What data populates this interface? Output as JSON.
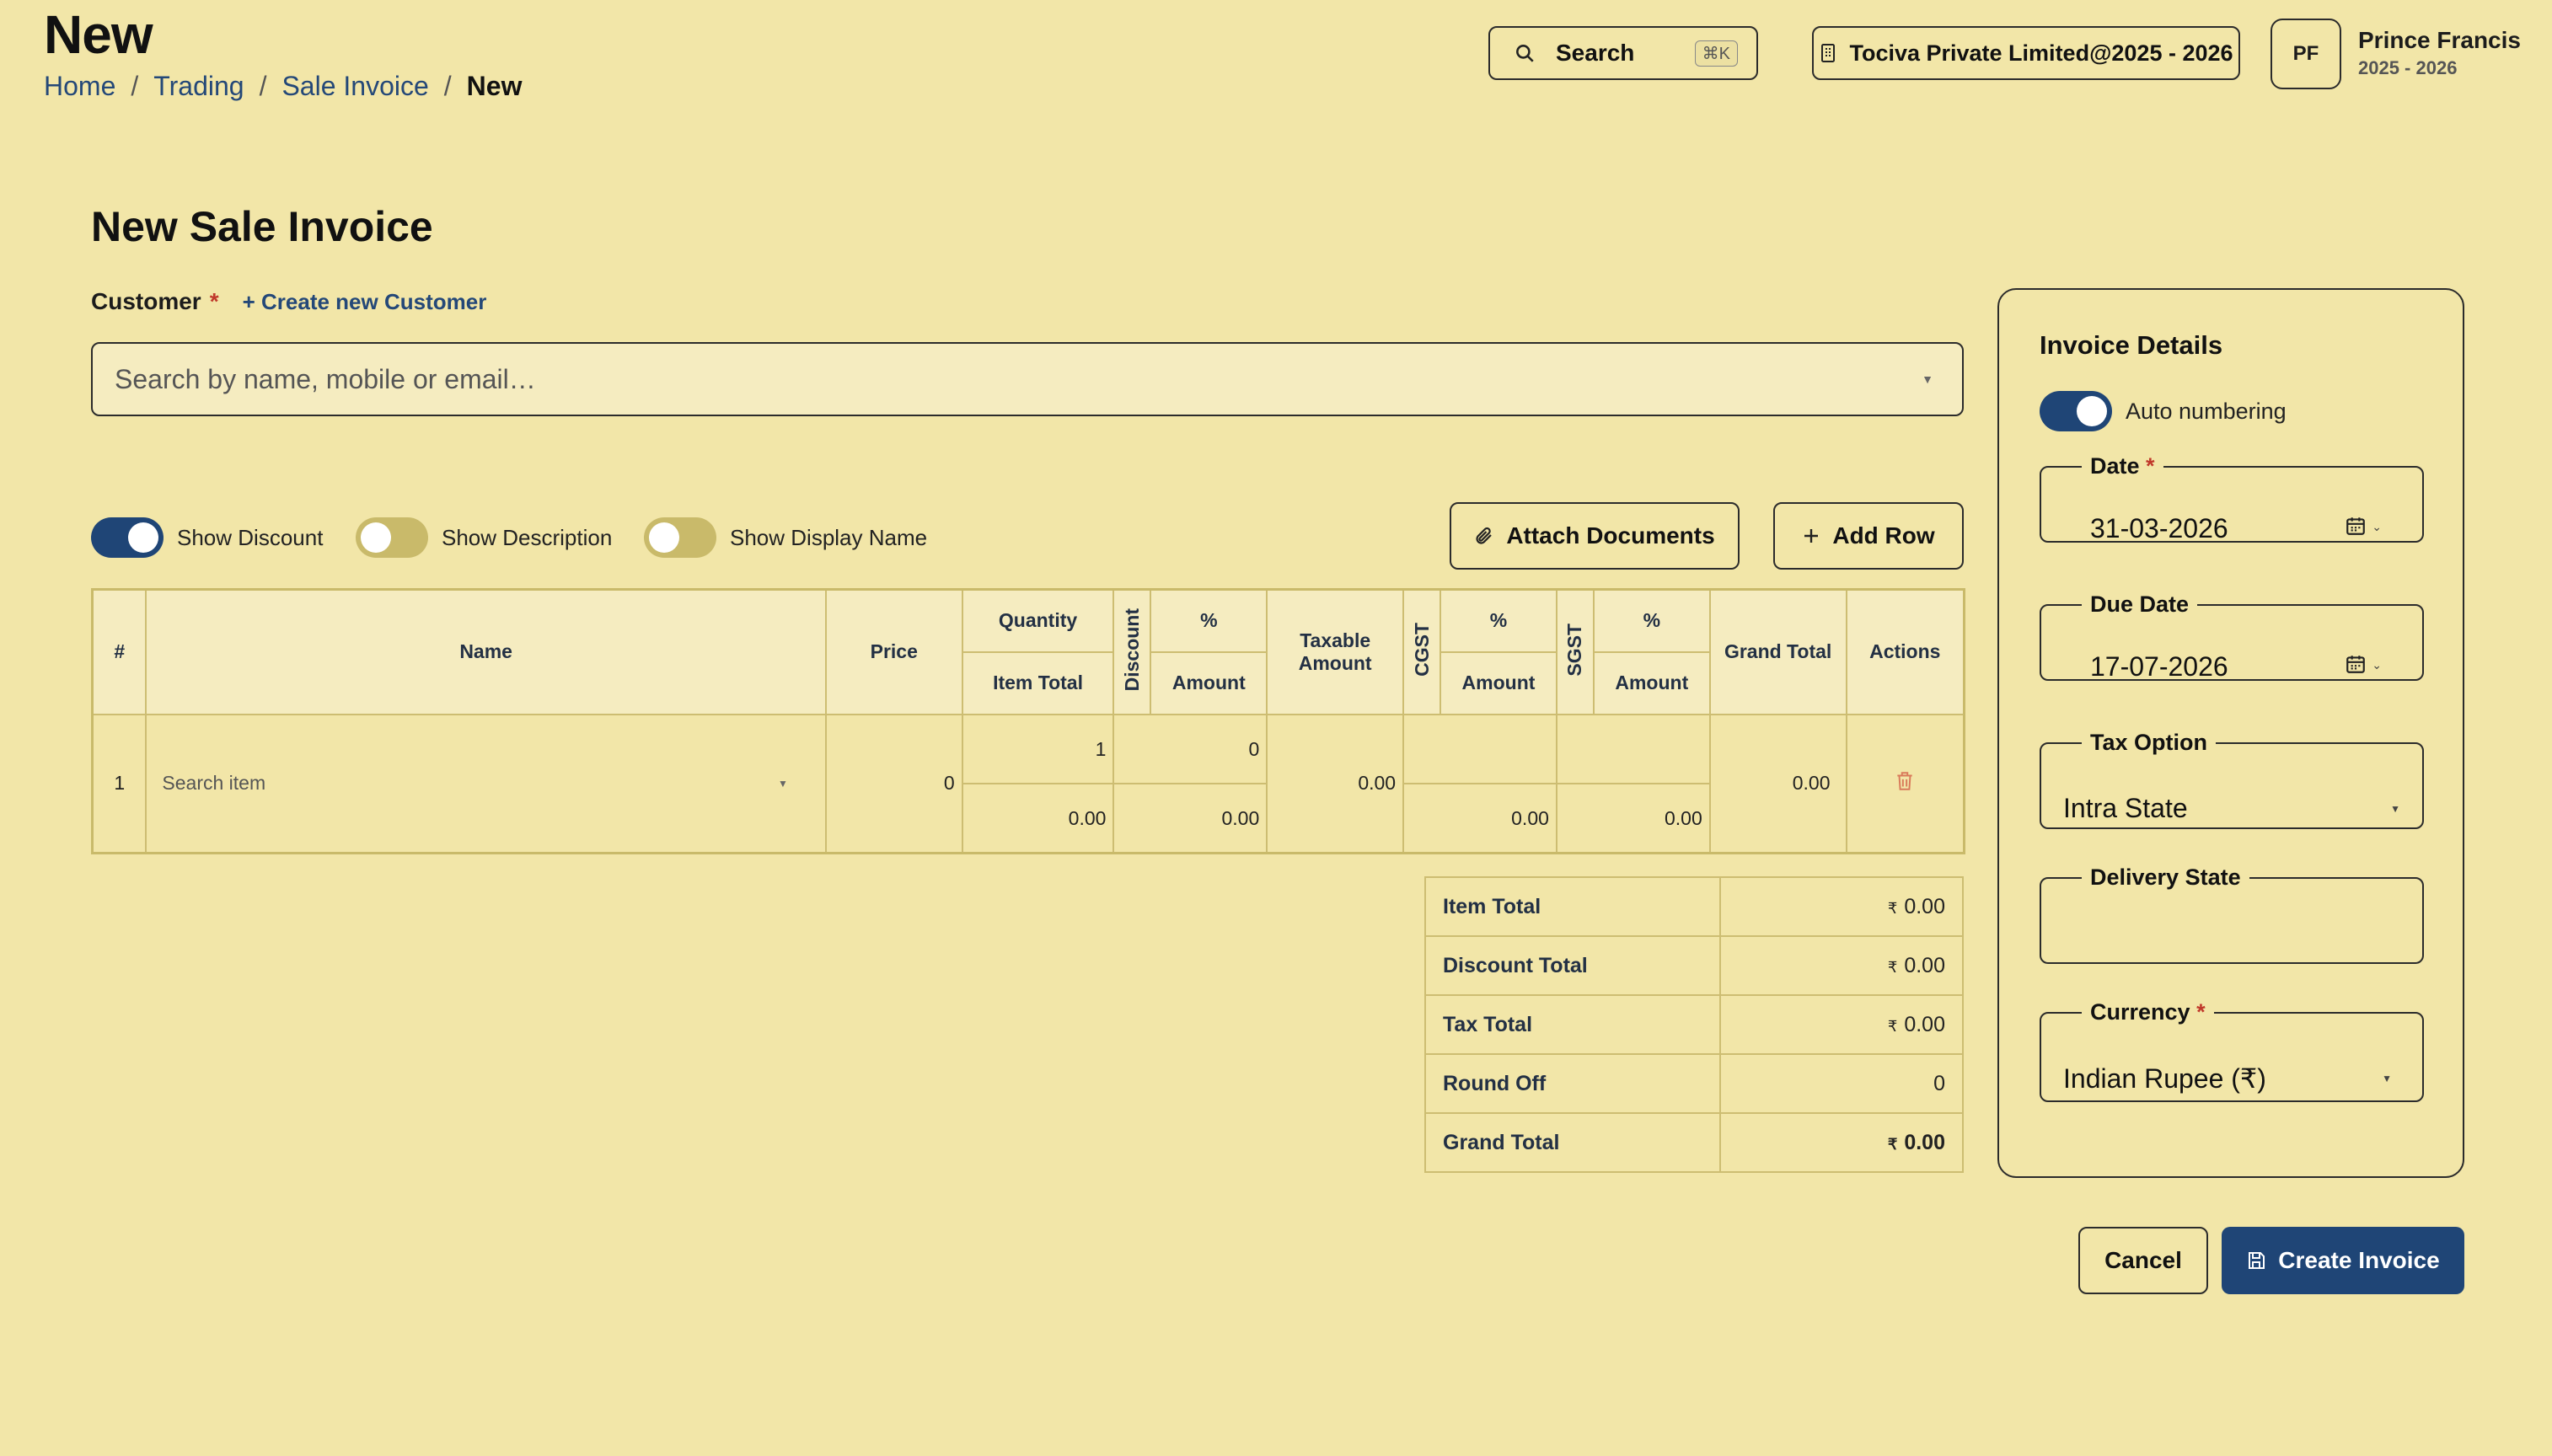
{
  "header": {
    "title": "New",
    "breadcrumb": [
      "Home",
      "Trading",
      "Sale Invoice",
      "New"
    ],
    "search_label": "Search",
    "search_shortcut": "⌘K",
    "company": "Tociva Private Limited@2025 - 2026",
    "user_initials": "PF",
    "user_name": "Prince Francis",
    "user_year": "2025 - 2026"
  },
  "form": {
    "heading": "New Sale Invoice",
    "customer_label": "Customer",
    "required_mark": "*",
    "create_customer_link": "+ Create new Customer",
    "customer_placeholder": "Search by name, mobile or email…"
  },
  "toggles": [
    {
      "label": "Show Discount",
      "on": true
    },
    {
      "label": "Show Description",
      "on": false
    },
    {
      "label": "Show Display Name",
      "on": false
    }
  ],
  "actions": {
    "attach": "Attach Documents",
    "add_row": "Add Row"
  },
  "table": {
    "headers": {
      "num": "#",
      "name": "Name",
      "price": "Price",
      "quantity": "Quantity",
      "item_total": "Item Total",
      "discount": "Discount",
      "pct": "%",
      "amount": "Amount",
      "taxable": "Taxable Amount",
      "cgst": "CGST",
      "sgst": "SGST",
      "grand_total": "Grand Total",
      "actions": "Actions"
    },
    "row": {
      "num": "1",
      "name_placeholder": "Search item",
      "price": "0",
      "quantity": "1",
      "item_total": "0.00",
      "discount_pct": "0",
      "discount_amount": "0.00",
      "taxable": "0.00",
      "cgst_pct": "",
      "cgst_amount": "0.00",
      "sgst_pct": "",
      "sgst_amount": "0.00",
      "grand_total": "0.00"
    }
  },
  "summary": [
    {
      "label": "Item Total",
      "currency": "₹",
      "value": "0.00"
    },
    {
      "label": "Discount Total",
      "currency": "₹",
      "value": "0.00"
    },
    {
      "label": "Tax Total",
      "currency": "₹",
      "value": "0.00"
    },
    {
      "label": "Round Off",
      "currency": "",
      "value": "0"
    },
    {
      "label": "Grand Total",
      "currency": "₹",
      "value": "0.00"
    }
  ],
  "invoice_details": {
    "heading": "Invoice Details",
    "auto_numbering": "Auto numbering",
    "auto_numbering_on": true,
    "date_label": "Date",
    "date_value": "31-03-2026",
    "due_date_label": "Due Date",
    "due_date_value": "17-07-2026",
    "tax_option_label": "Tax Option",
    "tax_option_value": "Intra State",
    "delivery_state_label": "Delivery State",
    "delivery_state_value": "",
    "currency_label": "Currency",
    "currency_value": "Indian Rupee (₹)"
  },
  "footer": {
    "cancel": "Cancel",
    "create": "Create Invoice"
  },
  "colors": {
    "background": "#f2e6a8",
    "primary": "#1f4576",
    "link": "#244878",
    "required": "#c0392b"
  }
}
